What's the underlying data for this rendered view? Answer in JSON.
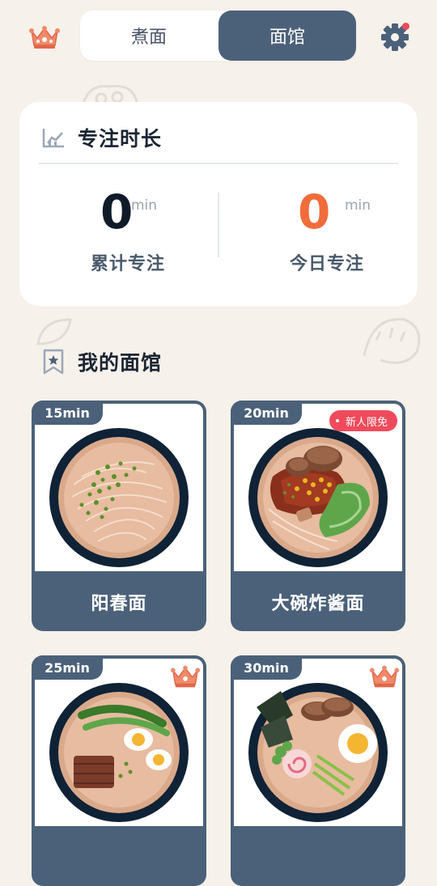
{
  "header": {
    "crown_icon": "crown-icon",
    "tabs": [
      {
        "label": "煮面",
        "active": false
      },
      {
        "label": "面馆",
        "active": true
      }
    ],
    "settings_icon": "gear-icon",
    "has_notification": true
  },
  "focus_card": {
    "title": "专注时长",
    "icon": "chart-icon",
    "total": {
      "value": "0",
      "unit": "min",
      "label": "累计专注"
    },
    "today": {
      "value": "0",
      "unit": "min",
      "label": "今日专注"
    }
  },
  "section": {
    "title": "我的面馆",
    "icon": "bookmark-star-icon"
  },
  "noodles": [
    {
      "time": "15min",
      "name": "阳春面",
      "badge": "",
      "premium": false
    },
    {
      "time": "20min",
      "name": "大碗炸酱面",
      "badge": "新人限免",
      "premium": false
    },
    {
      "time": "25min",
      "name": "",
      "badge": "",
      "premium": true
    },
    {
      "time": "30min",
      "name": "",
      "badge": "",
      "premium": true
    }
  ],
  "colors": {
    "background": "#f6f1ea",
    "primary": "#4b6179",
    "accent_orange": "#f06c3b",
    "badge_red": "#ef4b5c",
    "crown": "#f08a6a"
  }
}
